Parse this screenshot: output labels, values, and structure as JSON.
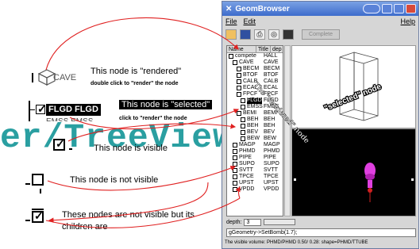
{
  "annotations": {
    "rendered_text": "This node is \"rendered\"",
    "rendered_hint": "double click to \"render\" the node",
    "rendered_node_label": "CAVE",
    "selected_text": "This node is \"selected\"",
    "selected_hint": "click to \"render\" the node",
    "selected_node_label": "FLGD FLGD",
    "selected_partial_below": "EMSS EMSS",
    "visible_text": "This node is visible",
    "not_visible_text": "This node is not visible",
    "children_text_1": "These nodes are not visible but its",
    "children_text_2": "children are"
  },
  "watermark": "er/TreeView.pn",
  "window": {
    "title": "GeomBrowser",
    "menu": {
      "file": "File",
      "edit": "Edit",
      "help": "Help"
    },
    "toolbar": {
      "complete_label": "Complete"
    },
    "tree": {
      "columns": [
        "Name",
        "Title",
        "dep"
      ],
      "rows": [
        {
          "name": "compete",
          "title": "HALL",
          "indent": 0
        },
        {
          "name": "CAVE",
          "title": "CAVE",
          "indent": 1
        },
        {
          "name": "BECM",
          "title": "BECM",
          "indent": 2
        },
        {
          "name": "BTOF",
          "title": "BTOF",
          "indent": 2
        },
        {
          "name": "CALB",
          "title": "CALB",
          "indent": 2
        },
        {
          "name": "ECAL",
          "title": "ECAL",
          "indent": 2
        },
        {
          "name": "FPCF",
          "title": "FPCF",
          "indent": 2
        },
        {
          "name": "FLGD",
          "title": "FLGD",
          "indent": 3,
          "selected": true
        },
        {
          "name": "EMSS",
          "title": "FMSS",
          "indent": 3
        },
        {
          "name": "BEMI",
          "title": "BEMI",
          "indent": 2
        },
        {
          "name": "BEH",
          "title": "BEH",
          "indent": 3
        },
        {
          "name": "BEH",
          "title": "BEH",
          "indent": 3
        },
        {
          "name": "BEV",
          "title": "BEV",
          "indent": 3
        },
        {
          "name": "BEW",
          "title": "BEW",
          "indent": 3
        },
        {
          "name": "MAGP",
          "title": "MAGP",
          "indent": 1
        },
        {
          "name": "PHMD",
          "title": "PHMD",
          "indent": 1
        },
        {
          "name": "PIPE",
          "title": "PIPE",
          "indent": 1
        },
        {
          "name": "SUPO",
          "title": "SUPO",
          "indent": 1
        },
        {
          "name": "SVTT",
          "title": "SVTT",
          "indent": 1
        },
        {
          "name": "TPCE",
          "title": "TPCE",
          "indent": 1
        },
        {
          "name": "UPST",
          "title": "UPST",
          "indent": 1
        },
        {
          "name": "VPDD",
          "title": "VPDD",
          "indent": 1
        }
      ]
    },
    "depth_label": "depth:",
    "depth_value": "3",
    "command": "gGeometry->SetBomb(1.7);",
    "status": "The visible volume: PHMD/PHMD  0.50/  0.28: shape=PHMD/TTUBE",
    "view_labels": {
      "selected_node": "\"selected\" node",
      "rendered_node": "The \"rendered\" node"
    }
  },
  "colors": {
    "arrow": "#e02020",
    "watermark": "#1f9a9c",
    "titlebar": "#3d6ccc",
    "render_magenta": "#e040e0"
  }
}
